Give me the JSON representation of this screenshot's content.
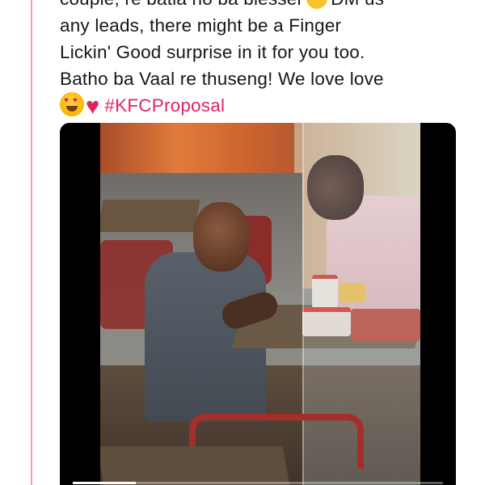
{
  "tweet": {
    "lines": [
      "couple, re batla ho ba blesser",
      "DM us",
      "any leads, there might be a Finger",
      "Lickin' Good surprise in it for you too.",
      "Batho ba Vaal re thuseng! We love love"
    ],
    "hashtag": "#KFCProposal",
    "emojis": [
      "smiling-face-icon",
      "heart-eyes-icon",
      "red-heart-icon"
    ],
    "hashtag_color": "#e0245e"
  },
  "video": {
    "progress": 0.17
  }
}
